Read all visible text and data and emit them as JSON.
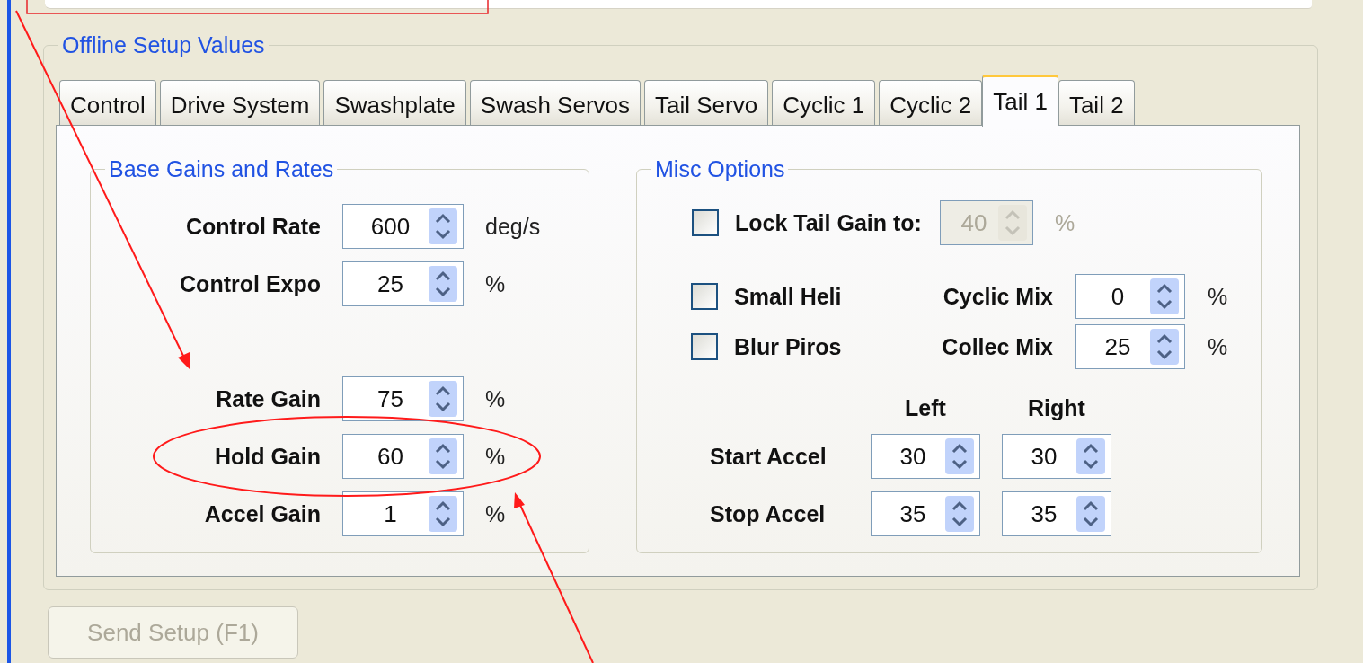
{
  "group": {
    "title": "Offline Setup Values"
  },
  "tabs": [
    {
      "label": "Control",
      "selected": false
    },
    {
      "label": "Drive System",
      "selected": false
    },
    {
      "label": "Swashplate",
      "selected": false
    },
    {
      "label": "Swash Servos",
      "selected": false
    },
    {
      "label": "Tail Servo",
      "selected": false
    },
    {
      "label": "Cyclic 1",
      "selected": false
    },
    {
      "label": "Cyclic 2",
      "selected": false
    },
    {
      "label": "Tail 1",
      "selected": true
    },
    {
      "label": "Tail 2",
      "selected": false
    }
  ],
  "base_gains": {
    "title": "Base Gains and Rates",
    "rates": [
      {
        "label": "Control Rate",
        "value": "600",
        "unit": "deg/s"
      },
      {
        "label": "Control Expo",
        "value": "25",
        "unit": "%"
      }
    ],
    "gains": [
      {
        "label": "Rate Gain",
        "value": "75",
        "unit": "%"
      },
      {
        "label": "Hold Gain",
        "value": "60",
        "unit": "%"
      },
      {
        "label": "Accel Gain",
        "value": "1",
        "unit": "%"
      }
    ]
  },
  "misc_options": {
    "title": "Misc Options",
    "lock_tail_gain": {
      "label": "Lock Tail Gain to:",
      "checked": false,
      "value": "40",
      "unit": "%",
      "disabled": true
    },
    "checkboxes": [
      {
        "label": "Small Heli",
        "checked": false
      },
      {
        "label": "Blur Piros",
        "checked": false
      }
    ],
    "mixes": [
      {
        "label": "Cyclic Mix",
        "value": "0",
        "unit": "%"
      },
      {
        "label": "Collec Mix",
        "value": "25",
        "unit": "%"
      }
    ],
    "accel": {
      "columns": [
        "Left",
        "Right"
      ],
      "rows": [
        {
          "label": "Start Accel",
          "values": [
            "30",
            "30"
          ]
        },
        {
          "label": "Stop Accel",
          "values": [
            "35",
            "35"
          ]
        }
      ]
    }
  },
  "send_button": {
    "label": "Send Setup (F1)",
    "disabled": true
  }
}
